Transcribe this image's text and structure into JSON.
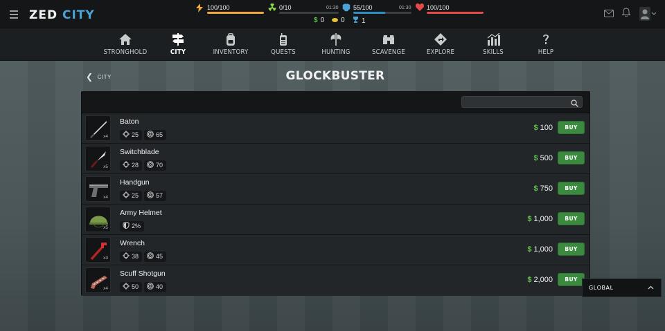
{
  "app": {
    "logo_part1": "ZED",
    "logo_part2": "CITY"
  },
  "status": {
    "energy": {
      "value": "100/100",
      "fraction": 1.0,
      "color": "#f0a93a",
      "icon": "lightning-icon"
    },
    "radiation": {
      "value": "0/10",
      "timer": "01:30",
      "fraction": 0.0,
      "color": "#8bd44a",
      "icon": "radiation-icon"
    },
    "morale": {
      "value": "55/100",
      "timer": "01:30",
      "fraction": 0.55,
      "color": "#2b8fc6",
      "icon": "brain-icon"
    },
    "life": {
      "value": "100/100",
      "fraction": 1.0,
      "color": "#e34b4b",
      "icon": "heart-icon"
    }
  },
  "currency": {
    "money": "0",
    "points": "0",
    "trophies": "1"
  },
  "nav": [
    {
      "label": "STRONGHOLD",
      "icon": "house-icon",
      "active": false
    },
    {
      "label": "CITY",
      "icon": "signpost-icon",
      "active": true
    },
    {
      "label": "INVENTORY",
      "icon": "backpack-icon",
      "active": false
    },
    {
      "label": "QUESTS",
      "icon": "walkie-talkie-icon",
      "active": false
    },
    {
      "label": "HUNTING",
      "icon": "axe-icon",
      "active": false
    },
    {
      "label": "SCAVENGE",
      "icon": "binoculars-icon",
      "active": false
    },
    {
      "label": "EXPLORE",
      "icon": "compass-diamond-icon",
      "active": false
    },
    {
      "label": "SKILLS",
      "icon": "bar-chart-icon",
      "active": false
    },
    {
      "label": "HELP",
      "icon": "question-icon",
      "active": false
    }
  ],
  "breadcrumb": {
    "back_label": "CITY"
  },
  "page": {
    "title": "GLOCKBUSTER"
  },
  "search": {
    "placeholder": "",
    "value": ""
  },
  "items": [
    {
      "name": "Baton",
      "qty": "x4",
      "stats": [
        {
          "icon": "crosshair-icon",
          "value": "25"
        },
        {
          "icon": "target-icon",
          "value": "65"
        }
      ],
      "price": "100",
      "buy_label": "BUY",
      "image": "baton-icon"
    },
    {
      "name": "Switchblade",
      "qty": "x5",
      "stats": [
        {
          "icon": "crosshair-icon",
          "value": "28"
        },
        {
          "icon": "target-icon",
          "value": "70"
        }
      ],
      "price": "500",
      "buy_label": "BUY",
      "image": "knife-icon"
    },
    {
      "name": "Handgun",
      "qty": "x4",
      "stats": [
        {
          "icon": "crosshair-icon",
          "value": "25"
        },
        {
          "icon": "target-icon",
          "value": "57"
        }
      ],
      "price": "750",
      "buy_label": "BUY",
      "image": "handgun-icon"
    },
    {
      "name": "Army Helmet",
      "qty": "x5",
      "stats": [
        {
          "icon": "shield-icon",
          "value": "2%"
        }
      ],
      "price": "1,000",
      "buy_label": "BUY",
      "image": "helmet-icon"
    },
    {
      "name": "Wrench",
      "qty": "x3",
      "stats": [
        {
          "icon": "crosshair-icon",
          "value": "38"
        },
        {
          "icon": "target-icon",
          "value": "45"
        }
      ],
      "price": "1,000",
      "buy_label": "BUY",
      "image": "wrench-icon"
    },
    {
      "name": "Scuff Shotgun",
      "qty": "x4",
      "stats": [
        {
          "icon": "crosshair-icon",
          "value": "50"
        },
        {
          "icon": "target-icon",
          "value": "40"
        }
      ],
      "price": "2,000",
      "buy_label": "BUY",
      "image": "shotgun-icon"
    }
  ],
  "currency_symbol": "$",
  "chat": {
    "label": "GLOBAL"
  }
}
